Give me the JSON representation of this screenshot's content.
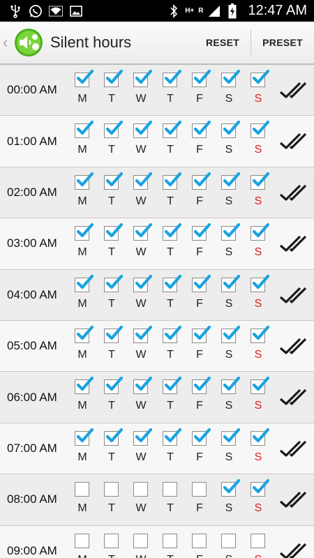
{
  "status_bar": {
    "time": "12:47 AM",
    "network_label_top": "H+",
    "network_label_side": "R",
    "icons": [
      "usb-icon",
      "whatsapp-icon",
      "wifi-icon",
      "image-icon",
      "bluetooth-icon",
      "signal-icon",
      "battery-charging-icon"
    ]
  },
  "action_bar": {
    "title": "Silent hours",
    "reset_label": "RESET",
    "preset_label": "PRESET"
  },
  "colors": {
    "check_blue": "#1aa3e0",
    "sunday_red": "#e01b1b"
  },
  "day_labels": [
    "M",
    "T",
    "W",
    "T",
    "F",
    "S",
    "S"
  ],
  "rows": [
    {
      "time": "00:00 AM",
      "days": [
        true,
        true,
        true,
        true,
        true,
        true,
        true
      ]
    },
    {
      "time": "01:00 AM",
      "days": [
        true,
        true,
        true,
        true,
        true,
        true,
        true
      ]
    },
    {
      "time": "02:00 AM",
      "days": [
        true,
        true,
        true,
        true,
        true,
        true,
        true
      ]
    },
    {
      "time": "03:00 AM",
      "days": [
        true,
        true,
        true,
        true,
        true,
        true,
        true
      ]
    },
    {
      "time": "04:00 AM",
      "days": [
        true,
        true,
        true,
        true,
        true,
        true,
        true
      ]
    },
    {
      "time": "05:00 AM",
      "days": [
        true,
        true,
        true,
        true,
        true,
        true,
        true
      ]
    },
    {
      "time": "06:00 AM",
      "days": [
        true,
        true,
        true,
        true,
        true,
        true,
        true
      ]
    },
    {
      "time": "07:00 AM",
      "days": [
        true,
        true,
        true,
        true,
        true,
        true,
        true
      ]
    },
    {
      "time": "08:00 AM",
      "days": [
        false,
        false,
        false,
        false,
        false,
        true,
        true
      ]
    },
    {
      "time": "09:00 AM",
      "days": [
        false,
        false,
        false,
        false,
        false,
        false,
        false
      ]
    }
  ]
}
